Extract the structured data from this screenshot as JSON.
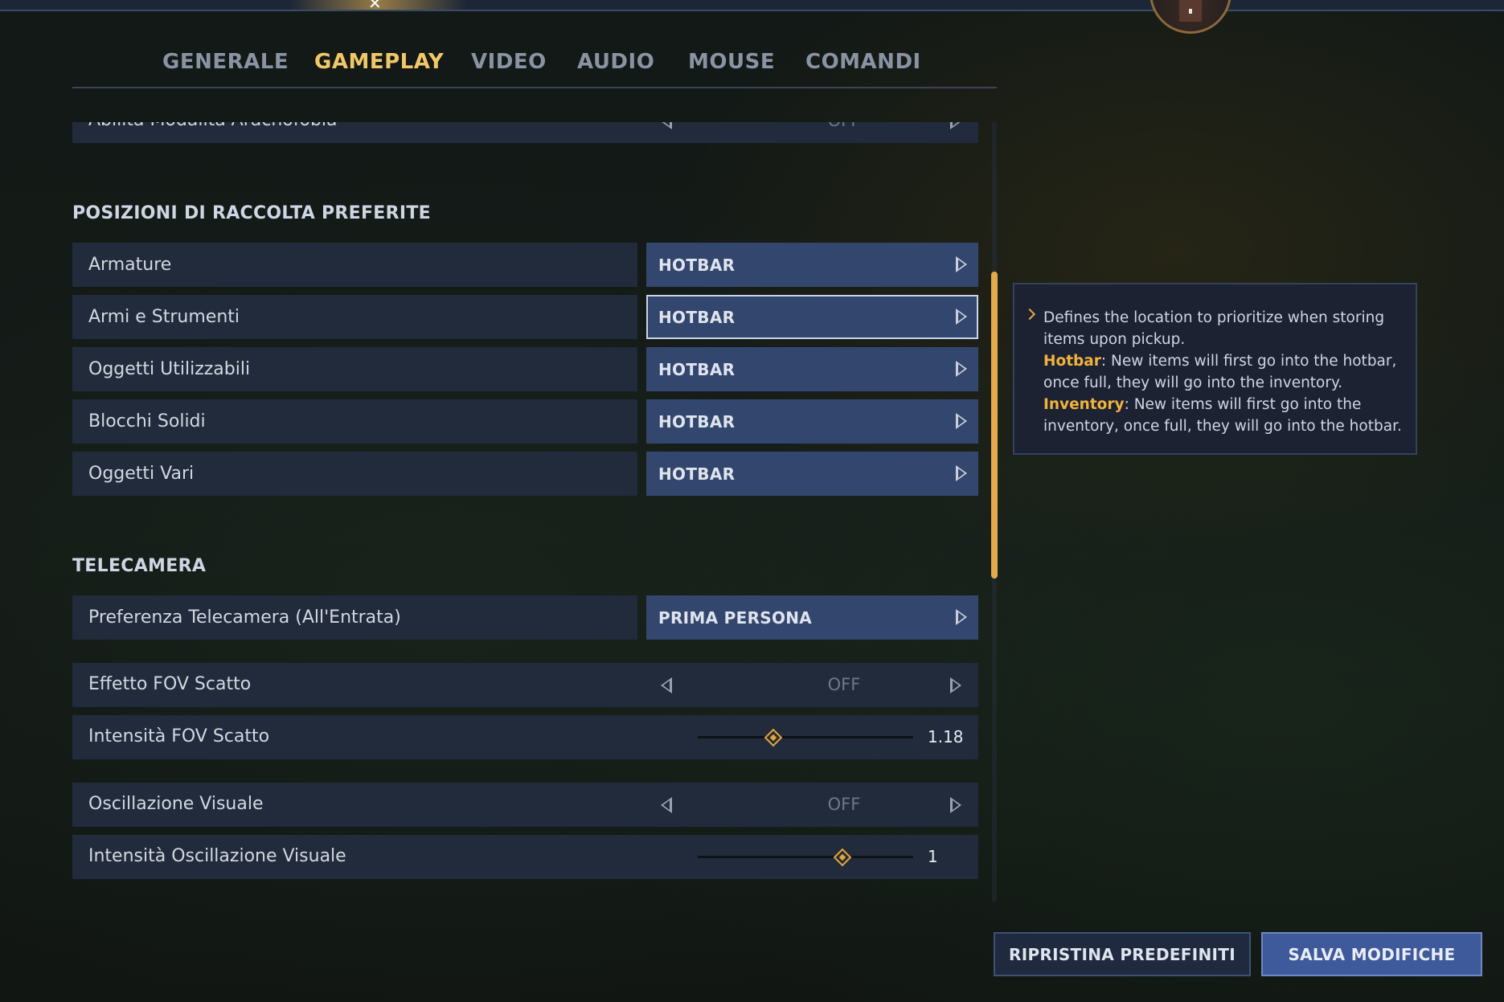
{
  "tabs": [
    {
      "label": "GENERALE",
      "active": false
    },
    {
      "label": "GAMEPLAY",
      "active": true
    },
    {
      "label": "VIDEO",
      "active": false
    },
    {
      "label": "AUDIO",
      "active": false
    },
    {
      "label": "MOUSE",
      "active": false
    },
    {
      "label": "COMANDI",
      "active": false
    }
  ],
  "partial_row": {
    "label": "Abilita Modalità Aracnofobia",
    "value": "OFF"
  },
  "pickup_section": {
    "title": "POSIZIONI DI RACCOLTA PREFERITE",
    "rows": [
      {
        "label": "Armature",
        "value": "HOTBAR"
      },
      {
        "label": "Armi e Strumenti",
        "value": "HOTBAR",
        "selected": true
      },
      {
        "label": "Oggetti Utilizzabili",
        "value": "HOTBAR"
      },
      {
        "label": "Blocchi Solidi",
        "value": "HOTBAR"
      },
      {
        "label": "Oggetti Vari",
        "value": "HOTBAR"
      }
    ]
  },
  "camera_section": {
    "title": "TELECAMERA",
    "camera_pref": {
      "label": "Preferenza Telecamera (All'Entrata)",
      "value": "PRIMA PERSONA"
    },
    "fov_effect": {
      "label": "Effetto FOV Scatto",
      "value": "OFF"
    },
    "fov_intensity": {
      "label": "Intensità FOV Scatto",
      "value": "1.18",
      "slider_fraction": 0.35
    },
    "view_bob": {
      "label": "Oscillazione Visuale",
      "value": "OFF"
    },
    "view_bob_intensity": {
      "label": "Intensità Oscillazione Visuale",
      "value": "1",
      "slider_fraction": 0.67
    }
  },
  "info": {
    "intro": "Defines the location to prioritize when storing items upon pickup.",
    "hotbar_term": "Hotbar",
    "hotbar_desc": ": New items will first go into the hotbar, once full, they will go into the inventory.",
    "inventory_term": "Inventory",
    "inventory_desc": ": New items will first go into the inventory, once full, they will go into the hotbar."
  },
  "buttons": {
    "reset": "RIPRISTINA PREDEFINITI",
    "save": "SALVA MODIFICHE"
  },
  "colors": {
    "accent": "#f1c869",
    "value_bg": "#33476e",
    "row_bg": "#212b3c"
  }
}
